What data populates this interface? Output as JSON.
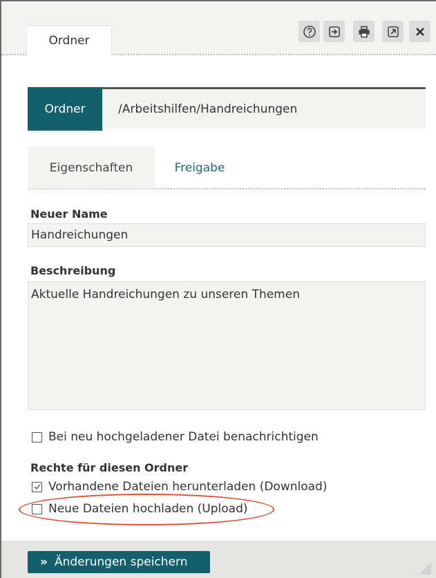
{
  "window": {
    "tab_title": "Ordner",
    "toolbar": {
      "help": "help-icon",
      "open": "open-in-icon",
      "print": "print-icon",
      "external": "external-link-icon",
      "close": "close-icon"
    }
  },
  "path": {
    "label": "Ordner",
    "value": "/Arbeitshilfen/Handreichungen"
  },
  "tabs": [
    {
      "label": "Eigenschaften",
      "active": true
    },
    {
      "label": "Freigabe",
      "active": false
    }
  ],
  "form": {
    "name_label": "Neuer Name",
    "name_value": "Handreichungen",
    "description_label": "Beschreibung",
    "description_value": "Aktuelle Handreichungen zu unseren Themen",
    "notify_label": "Bei neu hochgeladener Datei benachrichtigen",
    "notify_checked": false,
    "rights_heading": "Rechte für diesen Ordner",
    "rights": [
      {
        "label": "Vorhandene Dateien herunterladen (Download)",
        "checked": true
      },
      {
        "label": "Neue Dateien hochladen (Upload)",
        "checked": false
      }
    ]
  },
  "footer": {
    "save_label": "Änderungen speichern",
    "save_arrow": "»"
  },
  "colors": {
    "accent": "#11606b",
    "link": "#1b6a78",
    "highlight": "#d9503a"
  }
}
